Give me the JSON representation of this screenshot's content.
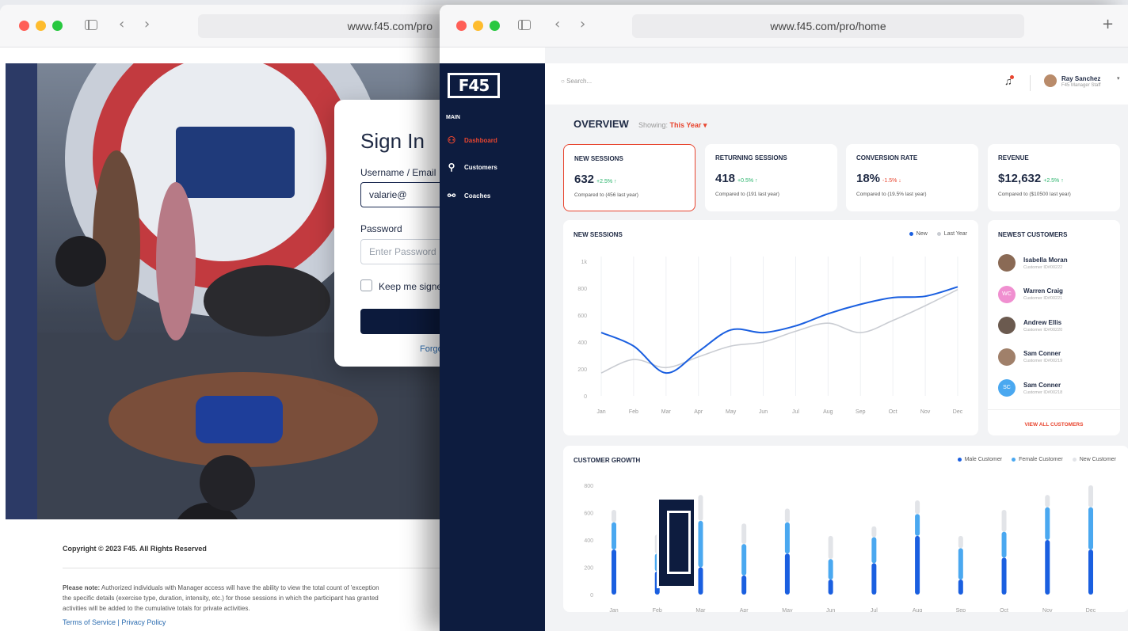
{
  "login_window": {
    "url": "www.f45.com/pro",
    "signin": {
      "title": "Sign In",
      "username_label": "Username / Email",
      "username_value": "valarie@",
      "password_label": "Password",
      "password_placeholder": "Enter Password",
      "remember_label": "Keep me signed",
      "forgot_label": "Forgo"
    },
    "copyright": "Copyright © 2023 F45. All Rights Reserved",
    "note_bold": "Please note:",
    "note_line1": "Authorized individuals with Manager access will have the ability to view the total count of 'exception",
    "note_line2": "the specific details (exercise type, duration, intensity, etc.) for those sessions in which the participant has granted",
    "note_line3": "activities will be added to the cumulative totals for private activities.",
    "terms": "Terms of Service",
    "privacy": "Privacy Policy",
    "sep": "|"
  },
  "dashboard_window": {
    "url": "www.f45.com/pro/home",
    "new_tab": "+",
    "sidebar": {
      "logo": "F45",
      "section": "MAIN",
      "items": [
        {
          "label": "Dashboard",
          "icon": "dashboard-icon",
          "glyph": "⚇"
        },
        {
          "label": "Customers",
          "icon": "user-icon",
          "glyph": "⚲"
        },
        {
          "label": "Coaches",
          "icon": "coach-icon",
          "glyph": "⚯"
        }
      ]
    },
    "topbar": {
      "search_placeholder": "Search...",
      "user_name": "Ray Sanchez",
      "user_role": "F45 Manager Staff"
    },
    "overview": {
      "title": "OVERVIEW",
      "showing_label": "Showing:",
      "period": "This Year ▾"
    },
    "kpis": [
      {
        "title": "NEW SESSIONS",
        "value": "632",
        "delta": "+2.5% ↑",
        "trend": "up",
        "compare": "Compared to (456 last year)"
      },
      {
        "title": "RETURNING SESSIONS",
        "value": "418",
        "delta": "+0.5% ↑",
        "trend": "up",
        "compare": "Compared to (191 last year)"
      },
      {
        "title": "CONVERSION RATE",
        "value": "18%",
        "delta": "-1.5% ↓",
        "trend": "down",
        "compare": "Compared to (19.5% last year)"
      },
      {
        "title": "REVENUE",
        "value": "$12,632",
        "delta": "+2.5% ↑",
        "trend": "up",
        "compare": "Compared to ($10500 last year)"
      }
    ],
    "customers": {
      "title": "NEWEST CUSTOMERS",
      "items": [
        {
          "name": "Isabella Moran",
          "id": "Customer ID#00222",
          "initials": "",
          "color": "#8a6a55"
        },
        {
          "name": "Warren Craig",
          "id": "Customer ID#00221",
          "initials": "WC",
          "color": "#f08fd0"
        },
        {
          "name": "Andrew Ellis",
          "id": "Customer ID#00220",
          "initials": "",
          "color": "#6b5a4f"
        },
        {
          "name": "Sam Conner",
          "id": "Customer ID#00219",
          "initials": "",
          "color": "#a0806a"
        },
        {
          "name": "Sam Conner",
          "id": "Customer ID#00218",
          "initials": "SC",
          "color": "#4aa8f0"
        }
      ],
      "view_all": "VIEW ALL CUSTOMERS"
    }
  },
  "chart_data": [
    {
      "type": "line",
      "title": "NEW SESSIONS",
      "categories": [
        "Jan",
        "Feb",
        "Mar",
        "Apr",
        "May",
        "Jun",
        "Jul",
        "Aug",
        "Sep",
        "Oct",
        "Nov",
        "Dec"
      ],
      "y_ticks": [
        "1k",
        "800",
        "600",
        "400",
        "200",
        "0"
      ],
      "ylim": [
        0,
        1000
      ],
      "grid": "vertical",
      "legend_position": "top-right",
      "series": [
        {
          "name": "New",
          "color": "#1a5fe0",
          "values": [
            470,
            370,
            170,
            330,
            490,
            470,
            520,
            610,
            680,
            730,
            740,
            810
          ]
        },
        {
          "name": "Last Year",
          "color": "#c9ccd2",
          "values": [
            170,
            270,
            210,
            290,
            370,
            400,
            480,
            540,
            470,
            560,
            670,
            790
          ]
        }
      ]
    },
    {
      "type": "bar",
      "title": "CUSTOMER GROWTH",
      "categories": [
        "Jan",
        "Feb",
        "Mar",
        "Apr",
        "May",
        "Jun",
        "Jul",
        "Aug",
        "Sep",
        "Oct",
        "Nov",
        "Dec"
      ],
      "y_ticks": [
        "800",
        "600",
        "400",
        "200",
        "0"
      ],
      "ylim": [
        0,
        800
      ],
      "stacked": true,
      "legend_position": "top-right",
      "series": [
        {
          "name": "Male Customer",
          "color": "#1a5fe0",
          "values": [
            330,
            170,
            200,
            140,
            300,
            110,
            230,
            430,
            110,
            270,
            400,
            330
          ]
        },
        {
          "name": "Female Customer",
          "color": "#4aa8f0",
          "values": [
            200,
            130,
            340,
            230,
            230,
            150,
            190,
            160,
            230,
            190,
            240,
            310
          ]
        },
        {
          "name": "New Customer",
          "color": "#e2e4e8",
          "values": [
            90,
            140,
            190,
            150,
            100,
            170,
            80,
            100,
            90,
            160,
            90,
            160
          ]
        }
      ]
    }
  ]
}
